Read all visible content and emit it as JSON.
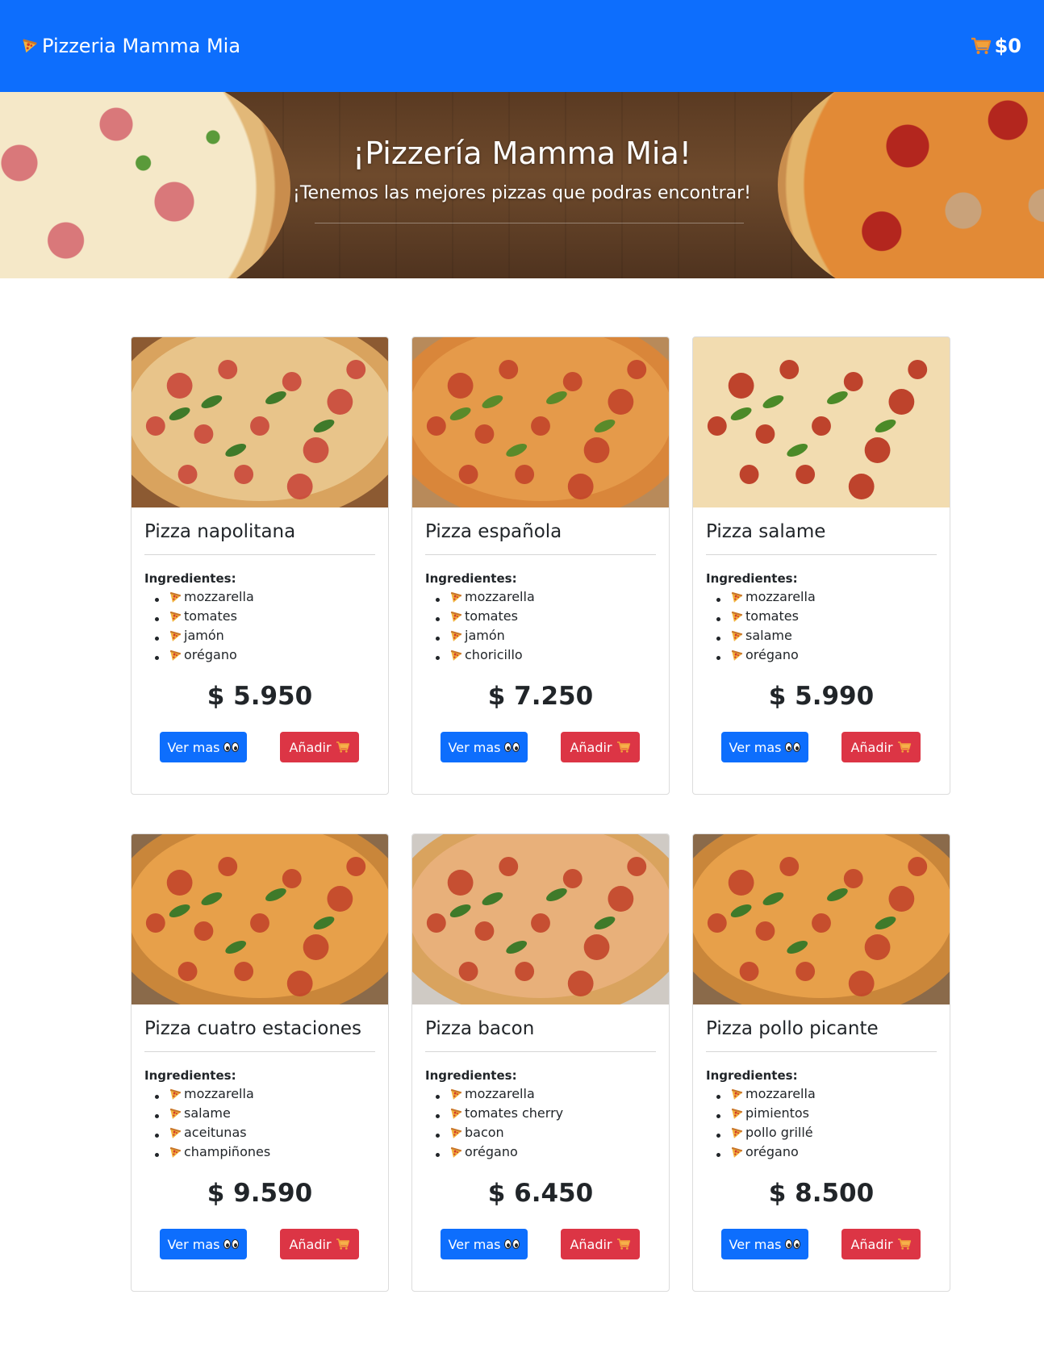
{
  "navbar": {
    "brand": "Pizzeria Mamma Mia",
    "brand_icon": "pizza-slice-icon",
    "cart_icon": "shopping-cart-icon",
    "cart_total": "$0"
  },
  "hero": {
    "title": "¡Pizzería Mamma Mia!",
    "subtitle": "¡Tenemos las mejores pizzas que podras encontrar!"
  },
  "card_labels": {
    "ingredients": "Ingredientes:",
    "more_button": "Ver mas",
    "add_button": "Añadir"
  },
  "pizzas": [
    {
      "name": "Pizza napolitana",
      "ingredients": [
        "mozzarella",
        "tomates",
        "jamón",
        "orégano"
      ],
      "price": "$ 5.950"
    },
    {
      "name": "Pizza española",
      "ingredients": [
        "mozzarella",
        "tomates",
        "jamón",
        "choricillo"
      ],
      "price": "$ 7.250"
    },
    {
      "name": "Pizza salame",
      "ingredients": [
        "mozzarella",
        "tomates",
        "salame",
        "orégano"
      ],
      "price": "$ 5.990"
    },
    {
      "name": "Pizza cuatro estaciones",
      "ingredients": [
        "mozzarella",
        "salame",
        "aceitunas",
        "champiñones"
      ],
      "price": "$ 9.590"
    },
    {
      "name": "Pizza bacon",
      "ingredients": [
        "mozzarella",
        "tomates cherry",
        "bacon",
        "orégano"
      ],
      "price": "$ 6.450"
    },
    {
      "name": "Pizza pollo picante",
      "ingredients": [
        "mozzarella",
        "pimientos",
        "pollo grillé",
        "orégano"
      ],
      "price": "$ 8.500"
    }
  ],
  "colors": {
    "primary": "#0d6efd",
    "danger": "#dc3545",
    "text": "#212529"
  }
}
